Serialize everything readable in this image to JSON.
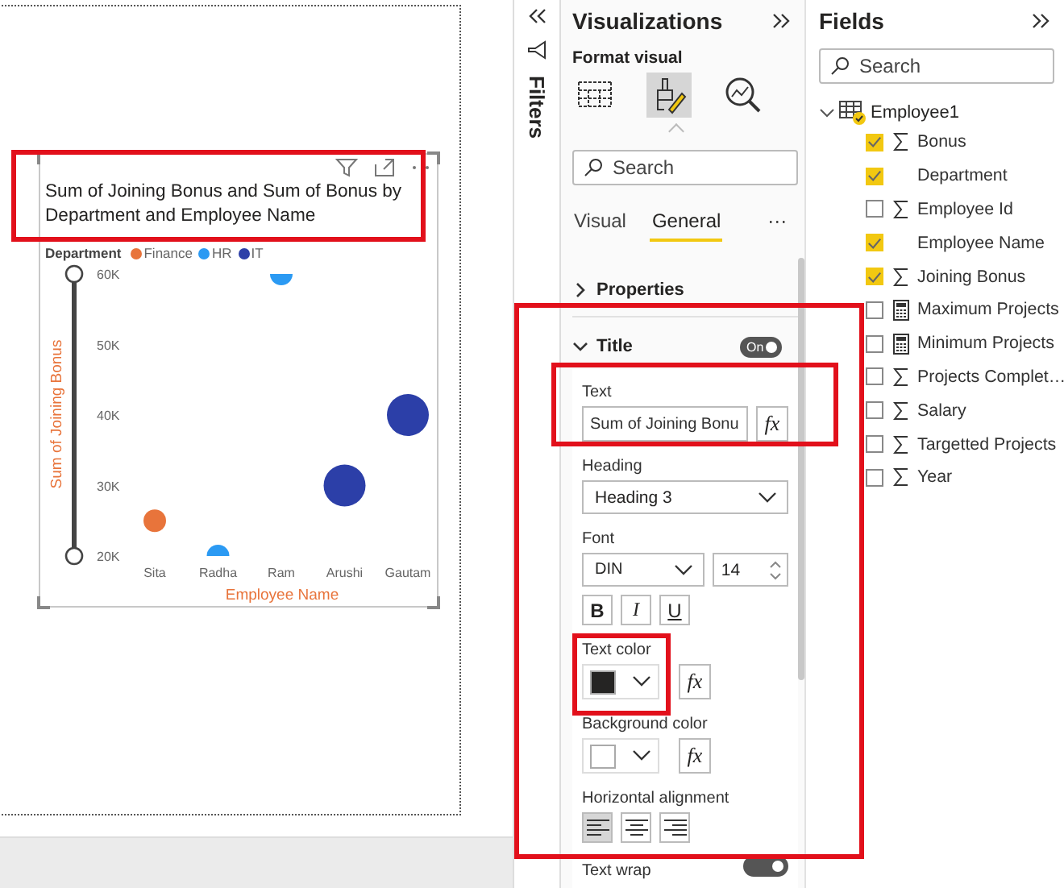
{
  "canvas": {
    "visual": {
      "title": "Sum of Joining Bonus and Sum of Bonus by Department and Employee Name",
      "legend_title": "Department",
      "chart_data": {
        "type": "scatter",
        "xlabel": "Employee Name",
        "ylabel": "Sum of Joining Bonus",
        "categories": [
          "Sita",
          "Radha",
          "Ram",
          "Arushi",
          "Gautam"
        ],
        "series": [
          {
            "name": "Finance",
            "color": "#e8743b",
            "values": [
              25000,
              null,
              null,
              null,
              null
            ]
          },
          {
            "name": "HR",
            "color": "#2b9af3",
            "values": [
              null,
              20000,
              60000,
              null,
              null
            ]
          },
          {
            "name": "IT",
            "color": "#2c3fa8",
            "values": [
              null,
              null,
              null,
              30000,
              40000
            ]
          }
        ],
        "ylim": [
          20000,
          60000
        ],
        "yticks": [
          {
            "value": 20000,
            "label": "20K"
          },
          {
            "value": 30000,
            "label": "30K"
          },
          {
            "value": 40000,
            "label": "40K"
          },
          {
            "value": 50000,
            "label": "50K"
          },
          {
            "value": 60000,
            "label": "60K"
          }
        ]
      }
    }
  },
  "filters_pane": {
    "title": "Filters"
  },
  "visualizations": {
    "title": "Visualizations",
    "subtitle": "Format visual",
    "view_icons": [
      {
        "kind": "fields",
        "selected": false
      },
      {
        "kind": "format",
        "selected": true
      },
      {
        "kind": "analytics",
        "selected": false
      }
    ],
    "search_placeholder": "Search",
    "tabs": [
      {
        "label": "Visual",
        "selected": false
      },
      {
        "label": "General",
        "selected": true
      }
    ],
    "more": "···",
    "sections": [
      {
        "label": "Properties",
        "expanded": false
      },
      {
        "label": "Title",
        "expanded": true,
        "toggle": "On",
        "on": true
      }
    ],
    "title_settings": {
      "text_label": "Text",
      "text_value": "Sum of Joining Bonu",
      "text_fx": "fx",
      "heading_label": "Heading",
      "heading_value": "Heading 3",
      "font_label": "Font",
      "font_family": "DIN",
      "font_size": "14",
      "styles": [
        {
          "label": "B",
          "kind": "bold",
          "selected": false
        },
        {
          "label": "I",
          "kind": "italic",
          "selected": false
        },
        {
          "label": "U",
          "kind": "underline",
          "selected": false
        }
      ],
      "text_color": {
        "label": "Text color",
        "color": "#252423",
        "fx": "fx"
      },
      "background_color": {
        "label": "Background color",
        "color": "#ffffff",
        "fx": "fx"
      },
      "alignment_label": "Horizontal alignment",
      "alignments": [
        {
          "kind": "left",
          "selected": true
        },
        {
          "kind": "center",
          "selected": false
        },
        {
          "kind": "right",
          "selected": false
        }
      ],
      "text_wrap_label": "Text wrap",
      "text_wrap": true
    }
  },
  "fields": {
    "title": "Fields",
    "search_placeholder": "Search",
    "table": {
      "name": "Employee1",
      "expanded": true,
      "children": [
        {
          "name": "Bonus",
          "kind": "measure",
          "checked": true
        },
        {
          "name": "Department",
          "kind": "text",
          "checked": true
        },
        {
          "name": "Employee Id",
          "kind": "measure",
          "checked": false
        },
        {
          "name": "Employee Name",
          "kind": "text",
          "checked": true
        },
        {
          "name": "Joining Bonus",
          "kind": "measure",
          "checked": true
        },
        {
          "name": "Maximum Projects",
          "kind": "calc",
          "checked": false
        },
        {
          "name": "Minimum Projects",
          "kind": "calc",
          "checked": false
        },
        {
          "name": "Projects Complet…",
          "kind": "measure",
          "checked": false
        },
        {
          "name": "Salary",
          "kind": "measure",
          "checked": false
        },
        {
          "name": "Targetted Projects",
          "kind": "measure",
          "checked": false
        },
        {
          "name": "Year",
          "kind": "measure",
          "checked": false
        }
      ]
    }
  }
}
